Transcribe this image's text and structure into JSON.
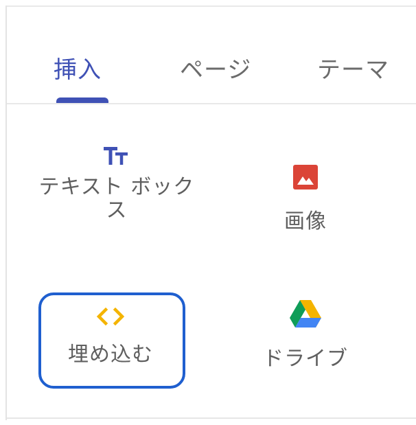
{
  "tabs": [
    {
      "label": "挿入",
      "active": true
    },
    {
      "label": "ページ",
      "active": false
    },
    {
      "label": "テーマ",
      "active": false
    }
  ],
  "items": {
    "textbox": {
      "label_line1": "テキスト ボック",
      "label_line2": "ス",
      "icon": "text-box-icon"
    },
    "image": {
      "label": "画像",
      "icon": "image-icon"
    },
    "embed": {
      "label": "埋め込む",
      "icon": "embed-code-icon",
      "selected": true
    },
    "drive": {
      "label": "ドライブ",
      "icon": "google-drive-icon"
    }
  },
  "colors": {
    "accent": "#3f51b5",
    "selection_outline": "#1f5fcf",
    "image_icon": "#db4437",
    "embed_icon": "#f4b400",
    "textbox_icon": "#3f51b5",
    "drive_green": "#0f9d58",
    "drive_yellow": "#f4b400",
    "drive_blue": "#4285f4"
  }
}
